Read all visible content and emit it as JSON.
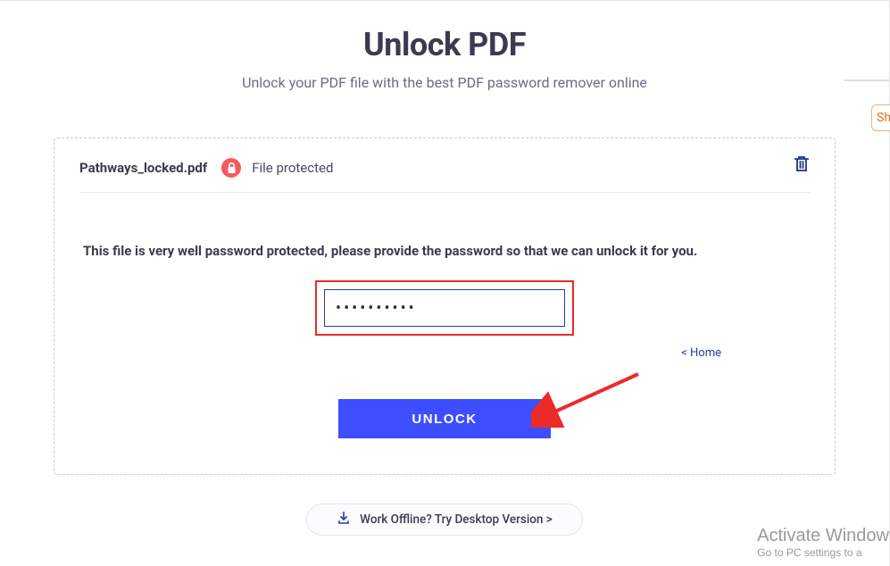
{
  "header": {
    "title": "Unlock PDF",
    "subtitle": "Unlock your PDF file with the best PDF password remover online"
  },
  "file": {
    "name": "Pathways_locked.pdf",
    "status": "File protected"
  },
  "content": {
    "instruction": "This file is very well password protected, please provide the password so that we can unlock it for you.",
    "password_value": "••••••••••",
    "home_link": "< Home",
    "unlock_label": "UNLOCK"
  },
  "footer": {
    "offline_label": "Work Offline? Try Desktop Version >"
  },
  "side": {
    "sh": "Sh"
  },
  "watermark": {
    "title": "Activate Window",
    "sub": "Go to PC settings to a"
  }
}
